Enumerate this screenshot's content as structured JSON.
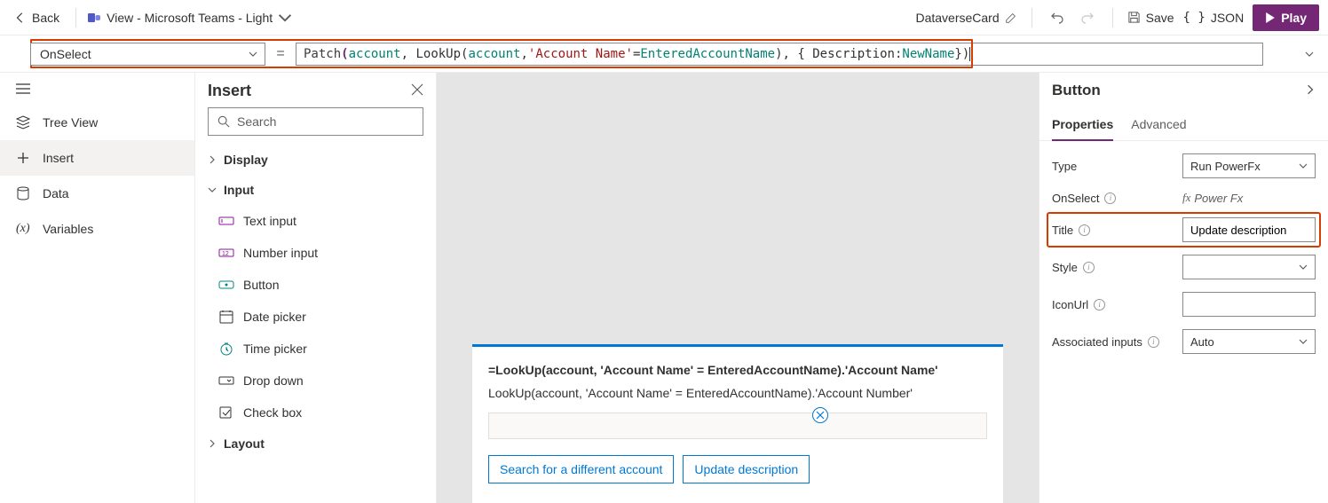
{
  "topbar": {
    "back": "Back",
    "theme_label": "View - Microsoft Teams - Light",
    "card_name": "DataverseCard",
    "save": "Save",
    "json": "JSON",
    "play": "Play"
  },
  "formula": {
    "property": "OnSelect",
    "tokens": {
      "t1": "Patch",
      "t2": "(",
      "t3": "account",
      "t4": ", LookUp(",
      "t5": "account",
      "t6": ", ",
      "t7": "'Account Name'",
      "t8": " = ",
      "t9": "EnteredAccountName",
      "t10": "), { Description: ",
      "t11": "NewName",
      "t12": " })"
    }
  },
  "leftnav": {
    "tree": "Tree View",
    "insert": "Insert",
    "data": "Data",
    "variables": "Variables"
  },
  "insert": {
    "title": "Insert",
    "search_placeholder": "Search",
    "groups": {
      "display": "Display",
      "input": "Input",
      "layout": "Layout"
    },
    "items": {
      "text_input": "Text input",
      "number_input": "Number input",
      "button": "Button",
      "date_picker": "Date picker",
      "time_picker": "Time picker",
      "drop_down": "Drop down",
      "check_box": "Check box"
    }
  },
  "card": {
    "line1": "=LookUp(account, 'Account Name' = EnteredAccountName).'Account Name'",
    "line2": "LookUp(account, 'Account Name' = EnteredAccountName).'Account Number'",
    "btn_search": "Search for a different account",
    "btn_update": "Update description"
  },
  "props": {
    "title": "Button",
    "tab_properties": "Properties",
    "tab_advanced": "Advanced",
    "rows": {
      "type_label": "Type",
      "type_value": "Run PowerFx",
      "onselect_label": "OnSelect",
      "onselect_value": "Power Fx",
      "title_label": "Title",
      "title_value": "Update description",
      "style_label": "Style",
      "style_value": "",
      "iconurl_label": "IconUrl",
      "iconurl_value": "",
      "inputs_label": "Associated inputs",
      "inputs_value": "Auto"
    }
  }
}
